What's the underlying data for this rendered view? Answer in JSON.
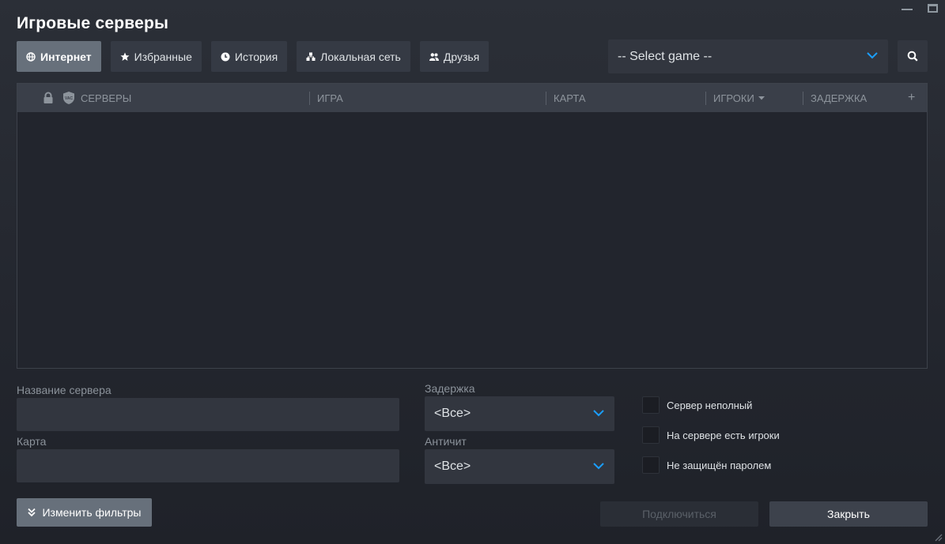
{
  "window": {
    "title": "Игровые серверы"
  },
  "tabs": [
    {
      "label": "Интернет",
      "icon": "globe-icon",
      "active": true
    },
    {
      "label": "Избранные",
      "icon": "star-icon",
      "active": false
    },
    {
      "label": "История",
      "icon": "clock-icon",
      "active": false
    },
    {
      "label": "Локальная сеть",
      "icon": "lan-icon",
      "active": false
    },
    {
      "label": "Друзья",
      "icon": "friends-icon",
      "active": false
    }
  ],
  "game_select": {
    "value": "-- Select game --"
  },
  "server_list": {
    "columns": {
      "servers": "СЕРВЕРЫ",
      "game": "ИГРА",
      "map": "КАРТА",
      "players": "ИГРОКИ",
      "latency": "ЗАДЕРЖКА",
      "add": "+"
    },
    "vac_label": "VAC",
    "rows": []
  },
  "filters": {
    "server_name_label": "Название сервера",
    "server_name_value": "",
    "map_label": "Карта",
    "map_value": "",
    "latency_label": "Задержка",
    "latency_value": "<Все>",
    "anticheat_label": "Античит",
    "anticheat_value": "<Все>",
    "checkboxes": [
      {
        "label": "Сервер неполный",
        "checked": false
      },
      {
        "label": "На сервере есть игроки",
        "checked": false
      },
      {
        "label": "Не защищён паролем",
        "checked": false
      }
    ]
  },
  "buttons": {
    "change_filters": "Изменить фильтры",
    "connect": "Подключиться",
    "close": "Закрыть"
  },
  "colors": {
    "accent_blue": "#1a9fff",
    "active_tab": "#67707b",
    "background": "#23262e"
  }
}
